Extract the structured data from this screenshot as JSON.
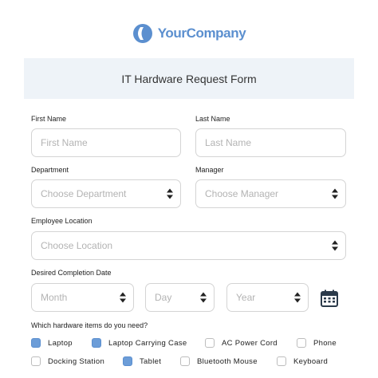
{
  "brand": {
    "name": "YourCompany",
    "color": "#5b8fcf"
  },
  "form": {
    "title": "IT Hardware Request Form",
    "first_name": {
      "label": "First Name",
      "placeholder": "First Name"
    },
    "last_name": {
      "label": "Last Name",
      "placeholder": "Last Name"
    },
    "department": {
      "label": "Department",
      "placeholder": "Choose Department"
    },
    "manager": {
      "label": "Manager",
      "placeholder": "Choose Manager"
    },
    "location": {
      "label": "Employee Location",
      "placeholder": "Choose Location"
    },
    "completion": {
      "label": "Desired Completion Date",
      "month_placeholder": "Month",
      "day_placeholder": "Day",
      "year_placeholder": "Year"
    },
    "hardware": {
      "question": "Which hardware items do you need?",
      "items": [
        {
          "label": "Laptop",
          "checked": true
        },
        {
          "label": "Laptop Carrying Case",
          "checked": true
        },
        {
          "label": "AC Power Cord",
          "checked": false
        },
        {
          "label": "Phone",
          "checked": false
        },
        {
          "label": "Docking Station",
          "checked": false
        },
        {
          "label": "Tablet",
          "checked": true
        },
        {
          "label": "Bluetooth Mouse",
          "checked": false
        },
        {
          "label": "Keyboard",
          "checked": false
        }
      ]
    }
  },
  "icons": {
    "calendar": "calendar-icon",
    "select_caret": "caret-up-down-icon"
  },
  "colors": {
    "banner_bg": "#eef3f8",
    "checkbox_checked": "#6c9dd8",
    "field_border": "#d4d4d4"
  }
}
